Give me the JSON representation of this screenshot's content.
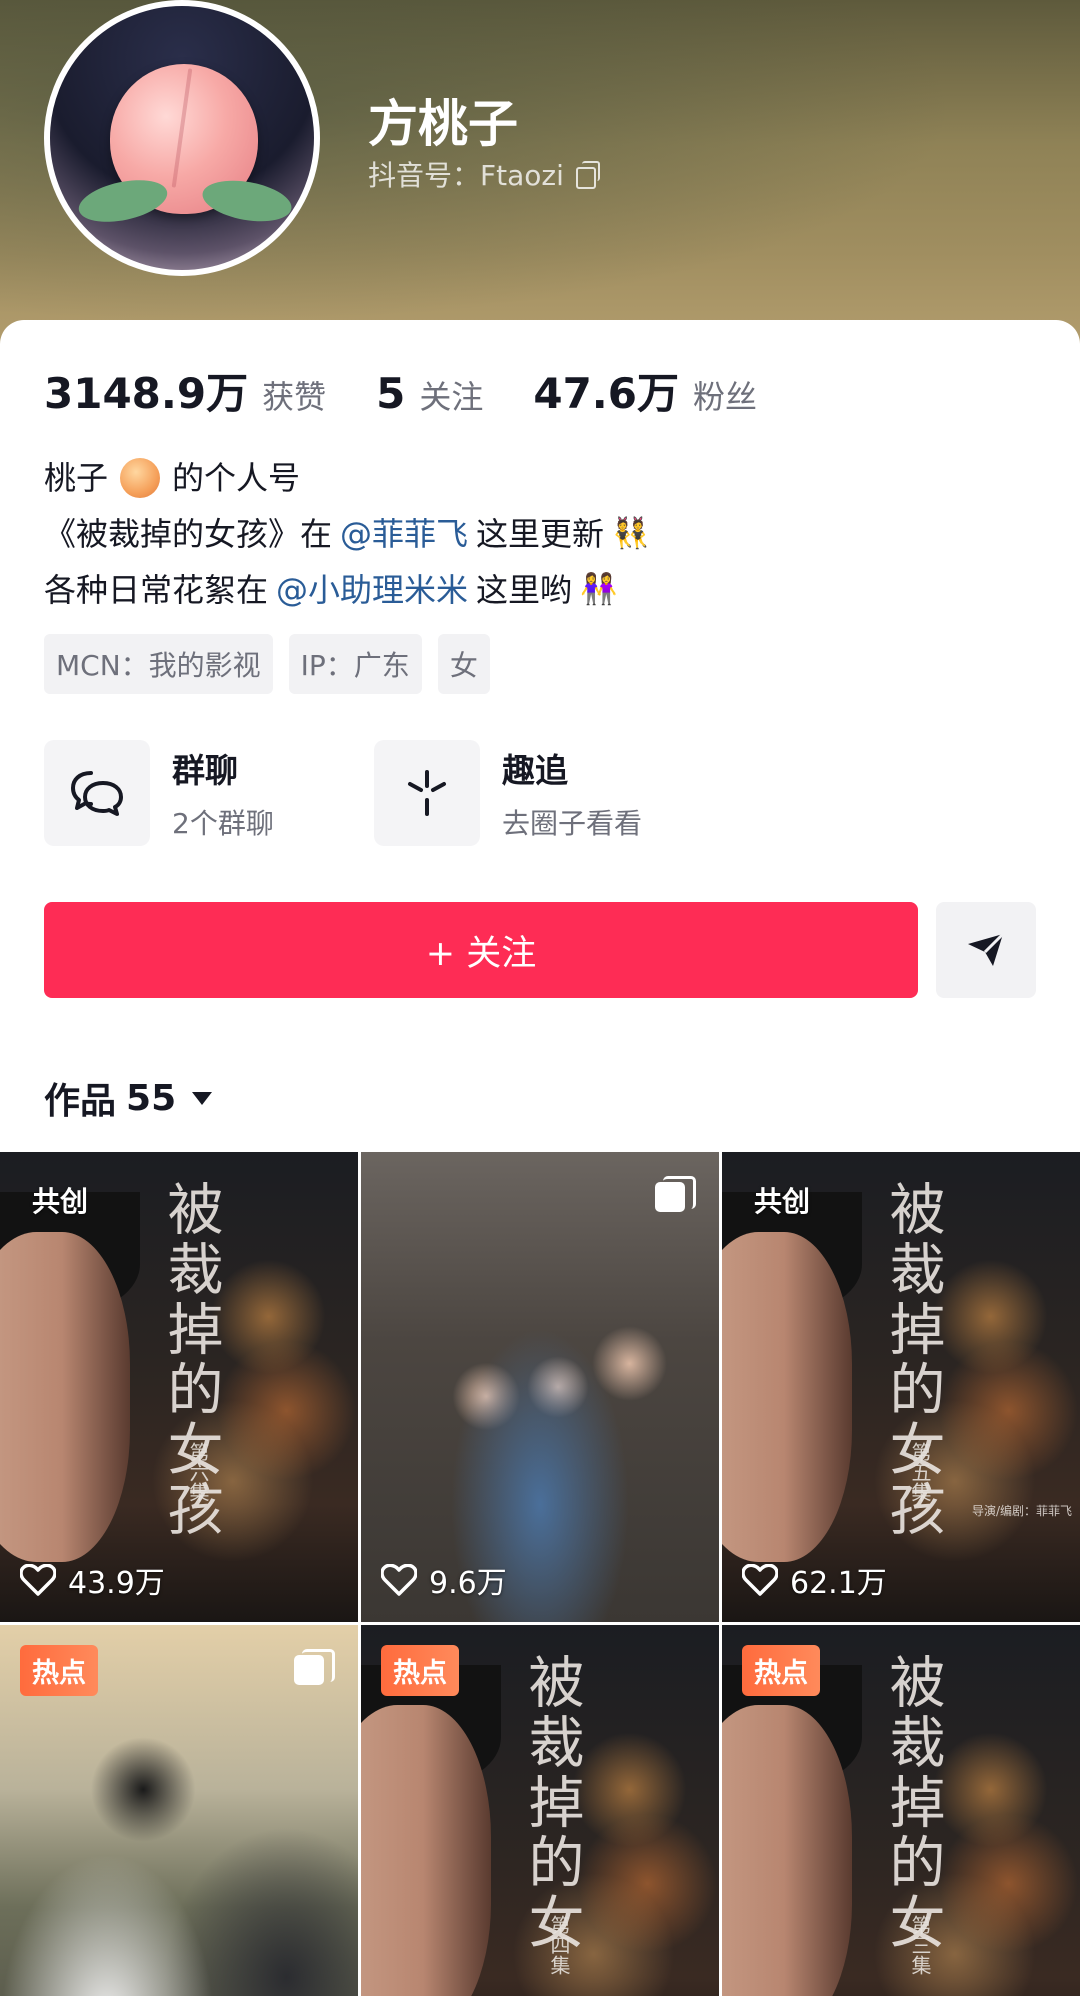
{
  "profile": {
    "nickname": "方桃子",
    "douyin_id": "抖音号：Ftaozi"
  },
  "stats": [
    {
      "value": "3148.9万",
      "label": "获赞"
    },
    {
      "value": "5",
      "label": "关注"
    },
    {
      "value": "47.6万",
      "label": "粉丝"
    }
  ],
  "bio": {
    "line1_a": "桃子",
    "line1_b": "的个人号",
    "line2_a": "《被裁掉的女孩》在",
    "line2_mention": "@菲菲飞",
    "line2_b": "这里更新",
    "line3_a": "各种日常花絮在",
    "line3_mention": "@小助理米米",
    "line3_b": "这里哟",
    "emoji_pair_1": "👯",
    "emoji_pair_2": "👭"
  },
  "tags": [
    "MCN：我的影视",
    "IP：广东",
    "女"
  ],
  "entries": [
    {
      "title": "群聊",
      "sub": "2个群聊",
      "icon": "chat-bubbles-icon"
    },
    {
      "title": "趣追",
      "sub": "去圈子看看",
      "icon": "sparkle-icon"
    }
  ],
  "actions": {
    "follow_label": "+ 关注",
    "share_icon": "send-icon"
  },
  "works": {
    "label": "作品",
    "count": "55"
  },
  "poster": {
    "title": "被裁掉的女孩",
    "title_short": "被裁掉的女",
    "director": "导演/编剧：菲菲飞"
  },
  "tiles": [
    {
      "type": "poster",
      "badge": "共创",
      "episode": "第六集",
      "likes": "43.9万"
    },
    {
      "type": "photo2",
      "badge": "",
      "likes": "9.6万",
      "multi": true
    },
    {
      "type": "poster",
      "badge": "共创",
      "episode": "第五集",
      "likes": "62.1万"
    },
    {
      "type": "photo4",
      "hot": "热点"
    },
    {
      "type": "poster",
      "hot": "热点",
      "episode": "第四集"
    },
    {
      "type": "poster",
      "hot": "热点",
      "episode": "第三集"
    }
  ],
  "colors": {
    "accent": "#fe2c55",
    "mention": "#2a5c97",
    "hot_badge": "#ff6b3d"
  }
}
